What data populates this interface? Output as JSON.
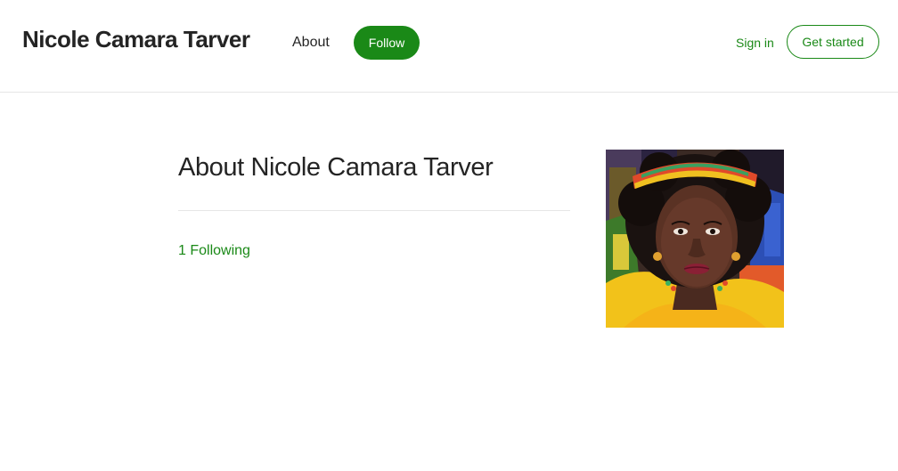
{
  "header": {
    "site_title": "Nicole Camara Tarver",
    "about_label": "About",
    "follow_label": "Follow",
    "sign_in_label": "Sign in",
    "get_started_label": "Get started"
  },
  "main": {
    "heading": "About Nicole Camara Tarver",
    "following_text": "1 Following"
  },
  "profile": {
    "avatar_icon": "profile-photo"
  },
  "colors": {
    "accent": "#1a8917",
    "text": "#242424",
    "divider": "#e6e6e6",
    "background": "#ffffff"
  }
}
